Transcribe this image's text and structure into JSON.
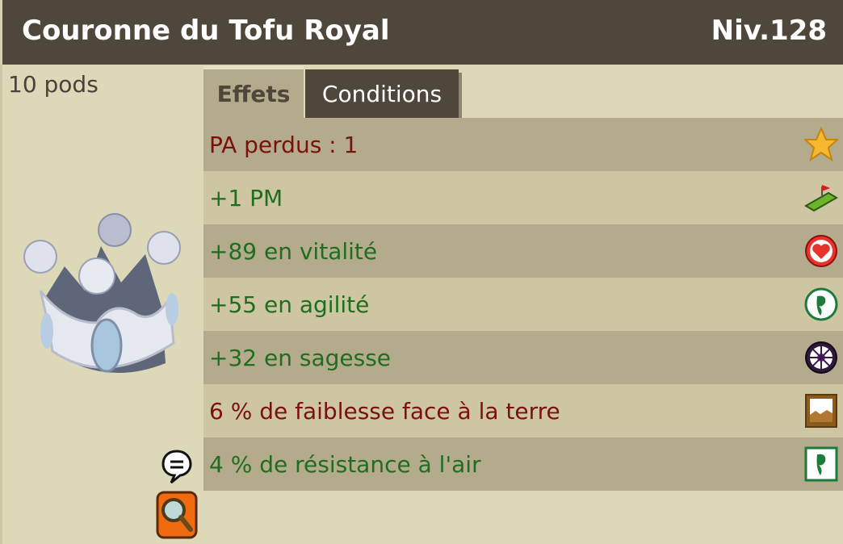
{
  "header": {
    "title": "Couronne du Tofu Royal",
    "level": "Niv.128"
  },
  "item": {
    "weight": "10 pods"
  },
  "tabs": [
    {
      "label": "Effets",
      "active": true
    },
    {
      "label": "Conditions",
      "active": false
    }
  ],
  "effects": [
    {
      "text": "PA perdus : 1",
      "kind": "negative",
      "icon": "star-icon"
    },
    {
      "text": "+1 PM",
      "kind": "positive",
      "icon": "movement-points-icon"
    },
    {
      "text": "+89 en vitalité",
      "kind": "positive",
      "icon": "heart-icon"
    },
    {
      "text": "+55 en agilité",
      "kind": "positive",
      "icon": "agility-icon"
    },
    {
      "text": "+32 en sagesse",
      "kind": "positive",
      "icon": "wisdom-icon"
    },
    {
      "text": "6 % de faiblesse face à la terre",
      "kind": "negative",
      "icon": "earth-resistance-icon"
    },
    {
      "text": "4 % de résistance à l'air",
      "kind": "positive",
      "icon": "air-resistance-icon"
    }
  ],
  "colors": {
    "header_bg": "#4f463c",
    "positive": "#1f6e1f",
    "negative": "#7a1010"
  }
}
